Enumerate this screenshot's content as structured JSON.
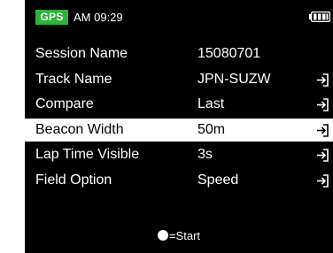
{
  "status": {
    "gps_label": "GPS",
    "time": "AM 09:29"
  },
  "settings": [
    {
      "label": "Session Name",
      "value": "15080701",
      "enter": false,
      "selected": false
    },
    {
      "label": "Track Name",
      "value": "JPN-SUZW",
      "enter": true,
      "selected": false
    },
    {
      "label": "Compare",
      "value": "Last",
      "enter": true,
      "selected": false
    },
    {
      "label": "Beacon Width",
      "value": "50m",
      "enter": true,
      "selected": true
    },
    {
      "label": "Lap Time Visible",
      "value": "3s",
      "enter": true,
      "selected": false
    },
    {
      "label": "Field Option",
      "value": "Speed",
      "enter": true,
      "selected": false
    }
  ],
  "footer": {
    "start_legend": "=Start"
  },
  "icons": {
    "enter": "enter-arrow-icon",
    "battery": "battery-icon",
    "start_button": "circle-button-icon"
  },
  "colors": {
    "gps_badge": "#2fb13a",
    "background": "#000000",
    "selected_row": "#ffffff"
  }
}
